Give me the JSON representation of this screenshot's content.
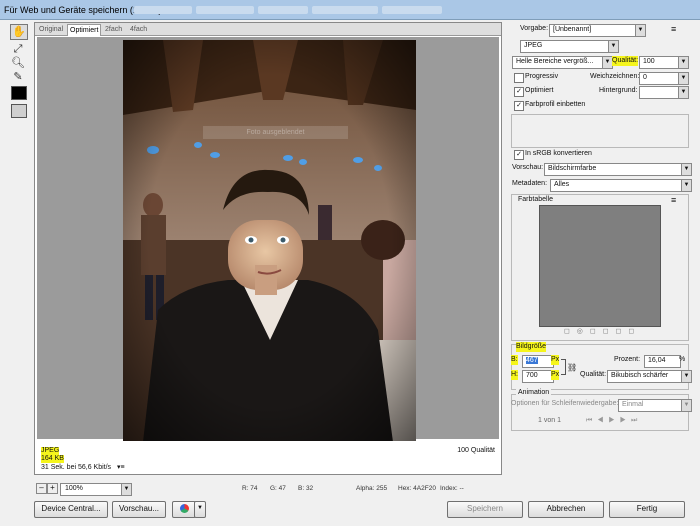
{
  "window": {
    "title": "Für Web und Geräte speichern (100 %)"
  },
  "tools": {
    "hand": "hand-icon",
    "slice_select": "slice-select-icon",
    "zoom": "zoom-icon",
    "eyedropper": "eyedropper-icon"
  },
  "tabs": [
    {
      "label": "Original"
    },
    {
      "label": "Optimiert"
    },
    {
      "label": "2fach"
    },
    {
      "label": "4fach"
    }
  ],
  "preview": {
    "format": "JPEG",
    "size": "164 KB",
    "download": "31 Sek. bei 56,6 Kbit/s",
    "quality": "100 Qualität",
    "menu_icon": "▾≡",
    "faded_label": "Foto ausgeblendet"
  },
  "bottom": {
    "zoom_minus": "–",
    "zoom_plus": "+",
    "zoom": "100%",
    "r": "R: 74",
    "g": "G: 47",
    "b": "B: 32",
    "alpha": "Alpha: 255",
    "hex": "Hex: 4A2F20",
    "index": "Index: --"
  },
  "buttons": {
    "device_central": "Device Central...",
    "preview": "Vorschau...",
    "save": "Speichern",
    "cancel": "Abbrechen",
    "done": "Fertig"
  },
  "settings": {
    "preset_label": "Vorgabe:",
    "preset": "[Unbenannt]",
    "format": "JPEG",
    "quality_mode": "Helle Bereiche vergröß...",
    "quality_label": "Qualität:",
    "quality": "100",
    "progressive": "Progressiv",
    "blur_label": "Weichzeichnen:",
    "blur": "0",
    "optimized": "Optimiert",
    "matte_label": "Hintergrund:",
    "embed_profile": "Farbprofil einbetten",
    "srgb": "In sRGB konvertieren",
    "preview_label": "Vorschau:",
    "preview_value": "Bildschirmfarbe",
    "metadata_label": "Metadaten:",
    "metadata_value": "Alles",
    "color_table": "Farbtabelle"
  },
  "image_size": {
    "heading": "Bildgröße",
    "w_label": "B:",
    "w": "467",
    "h_label": "H:",
    "h": "700",
    "unit": "Px",
    "percent_label": "Prozent:",
    "percent": "16,04",
    "percent_unit": "%",
    "quality_label": "Qualität:",
    "quality": "Bikubisch schärfer"
  },
  "animation": {
    "heading": "Animation",
    "loop_label": "Optionen für Schleifenwiedergabe:",
    "loop": "Einmal",
    "frame": "1 von 1"
  },
  "colors": {
    "highlight": "#f5f51c",
    "title_bar": "#aac7e6"
  }
}
